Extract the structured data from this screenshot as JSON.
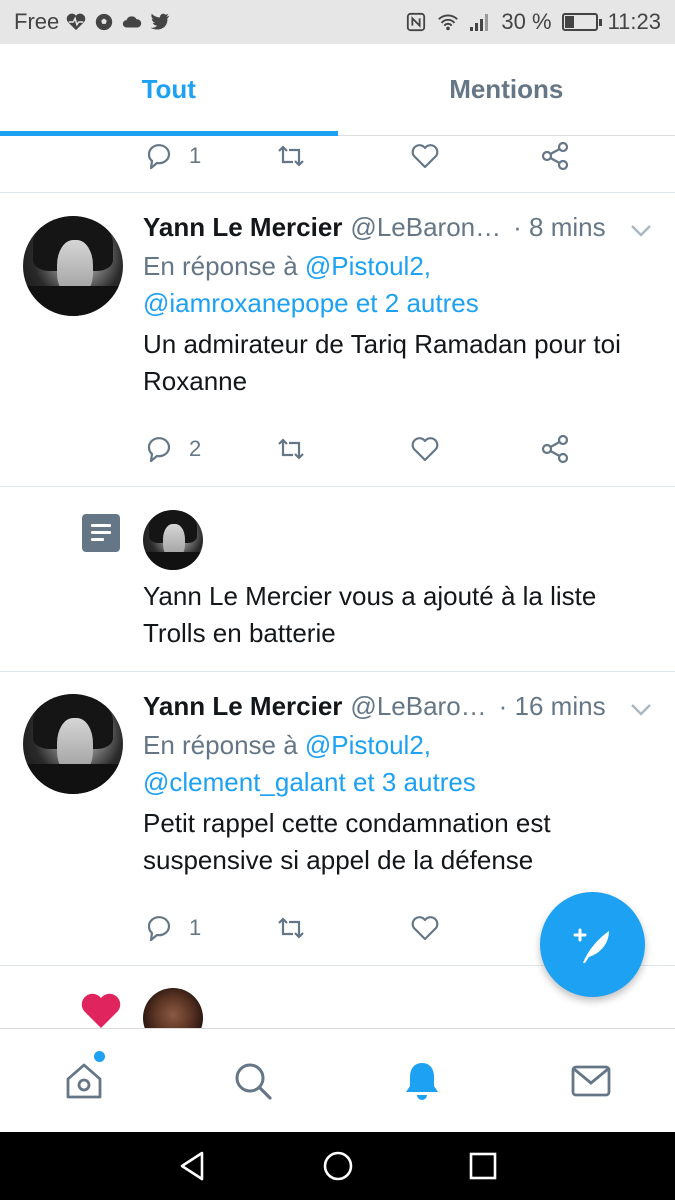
{
  "status_bar": {
    "carrier": "Free",
    "battery_percent": "30 %",
    "battery_level": 0.3,
    "time": "11:23",
    "icons": [
      "heart-pulse-icon",
      "soccer-ball-icon",
      "cloud-icon",
      "twitter-bird-icon",
      "nfc-icon",
      "wifi-icon",
      "signal-icon",
      "battery-icon"
    ]
  },
  "tabs": [
    {
      "label": "Tout",
      "active": true
    },
    {
      "label": "Mentions",
      "active": false
    }
  ],
  "feed": {
    "top_actions": {
      "reply_count": "1"
    },
    "tweet1": {
      "name": "Yann Le Mercier",
      "handle": "@LeBaron…",
      "time": "· 8 mins",
      "reply_prefix": "En réponse à",
      "reply_link1": "@Pistoul2,",
      "reply_link2": "@iamroxanepope et 2 autres",
      "text": "Un admirateur de Tariq Ramadan pour toi Roxanne",
      "reply_count": "2"
    },
    "list_notice": {
      "text": "Yann Le Mercier vous a ajouté à la liste Trolls en batterie"
    },
    "tweet2": {
      "name": "Yann Le Mercier",
      "handle": "@LeBaro…",
      "time": "· 16 mins",
      "reply_prefix": "En réponse à",
      "reply_link1": "@Pistoul2,",
      "reply_link2": "@clement_galant et 3 autres",
      "text": "Petit rappel cette condamnation est suspensive si appel de la défense",
      "reply_count": "1"
    }
  },
  "colors": {
    "accent": "#1da1f2",
    "muted": "#657786",
    "like_red": "#e0245e"
  },
  "bottom_nav": [
    "home-icon",
    "search-icon",
    "notifications-icon",
    "messages-icon"
  ],
  "system_nav": [
    "back-icon",
    "home-circle-icon",
    "recents-icon"
  ]
}
